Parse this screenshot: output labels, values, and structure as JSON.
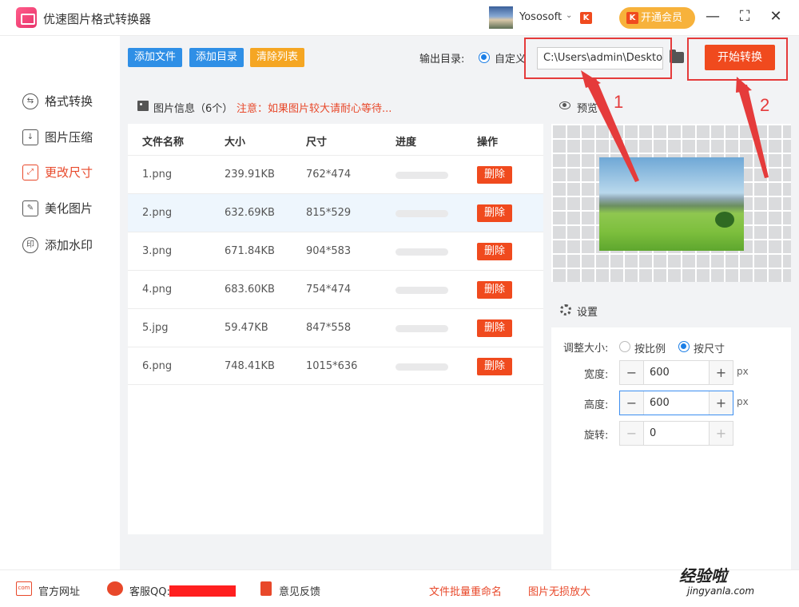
{
  "app": {
    "title": "优速图片格式转换器",
    "user_name": "Yososoft",
    "vip_label": "开通会员",
    "vip_badge": "K"
  },
  "window": {
    "minimize": "—",
    "maximize": "⛶",
    "close": "✕"
  },
  "sidebar": {
    "items": [
      {
        "label": "格式转换",
        "icon": "format-convert-icon",
        "active": false
      },
      {
        "label": "图片压缩",
        "icon": "compress-icon",
        "active": false
      },
      {
        "label": "更改尺寸",
        "icon": "resize-icon",
        "active": true
      },
      {
        "label": "美化图片",
        "icon": "beautify-icon",
        "active": false
      },
      {
        "label": "添加水印",
        "icon": "watermark-icon",
        "active": false
      }
    ]
  },
  "toolbar": {
    "add_file": "添加文件",
    "add_folder": "添加目录",
    "clear_list": "清除列表",
    "output_label": "输出目录:",
    "output_option": "自定义",
    "output_path": "C:\\Users\\admin\\Deskto",
    "start_label": "开始转换",
    "colors": {
      "blue": "#2f8fe6",
      "orange": "#f5a623",
      "accent": "#f04a1e"
    }
  },
  "list": {
    "header_title": "图片信息（6个）",
    "header_note": "注意：如果图片较大请耐心等待...",
    "columns": [
      "文件名称",
      "大小",
      "尺寸",
      "进度",
      "操作"
    ],
    "rows": [
      {
        "name": "1.png",
        "size": "239.91KB",
        "dims": "762*474",
        "action": "删除"
      },
      {
        "name": "2.png",
        "size": "632.69KB",
        "dims": "815*529",
        "action": "删除"
      },
      {
        "name": "3.png",
        "size": "671.84KB",
        "dims": "904*583",
        "action": "删除"
      },
      {
        "name": "4.png",
        "size": "683.60KB",
        "dims": "754*474",
        "action": "删除"
      },
      {
        "name": "5.jpg",
        "size": "59.47KB",
        "dims": "847*558",
        "action": "删除"
      },
      {
        "name": "6.png",
        "size": "748.41KB",
        "dims": "1015*636",
        "action": "删除"
      }
    ]
  },
  "preview": {
    "title": "预览"
  },
  "settings": {
    "title": "设置",
    "resize_label": "调整大小:",
    "opt_ratio": "按比例",
    "opt_size": "按尺寸",
    "width_label": "宽度:",
    "width_value": "600",
    "height_label": "高度:",
    "height_value": "600",
    "rotate_label": "旋转:",
    "rotate_value": "0",
    "unit": "px",
    "minus": "−",
    "plus": "+"
  },
  "annotations": {
    "one": "1",
    "two": "2"
  },
  "footer": {
    "website": "官方网址",
    "qq": "客服QQ:",
    "feedback": "意见反馈",
    "batch_rename": "文件批量重命名",
    "lossless": "图片无损放大",
    "watermark": "经验啦",
    "watermark_url": "jingyanla.com"
  }
}
